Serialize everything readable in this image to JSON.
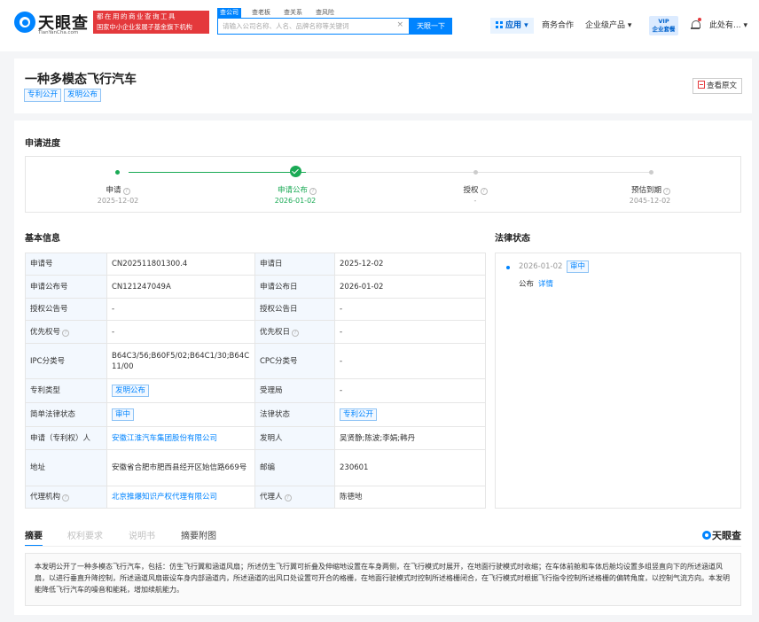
{
  "header": {
    "logo_text": "天眼查",
    "logo_sub": "TianYanCha.com",
    "banner_line1": "都在用的商业查询工具",
    "banner_line2": "国家中小企业发展子基金旗下机构",
    "search_tabs": [
      "查公司",
      "查老板",
      "查关系",
      "查风险"
    ],
    "search_placeholder": "请输入公司名称、人名、品牌名称等关键词",
    "search_clear": "×",
    "search_button": "天眼一下",
    "nav_app": "应用",
    "nav_business": "商务合作",
    "nav_enterprise": "企业级产品",
    "vip_line1": "VIP",
    "vip_line2": "企业套餐",
    "user_name": "此处有..."
  },
  "patent": {
    "title": "一种多模态飞行汽车",
    "tags": [
      "专利公开",
      "发明公布"
    ],
    "view_original": "查看原文"
  },
  "progress": {
    "title": "申请进度",
    "steps": [
      {
        "label": "申请",
        "date": "2025-12-02",
        "state": "done"
      },
      {
        "label": "申请公布",
        "date": "2026-01-02",
        "state": "current"
      },
      {
        "label": "授权",
        "date": "-",
        "state": "pending"
      },
      {
        "label": "预估到期",
        "date": "2045-12-02",
        "state": "pending"
      }
    ]
  },
  "basic_info": {
    "title": "基本信息",
    "rows": [
      {
        "k1": "申请号",
        "v1": "CN202511801300.4",
        "k2": "申请日",
        "v2": "2025-12-02"
      },
      {
        "k1": "申请公布号",
        "v1": "CN121247049A",
        "k2": "申请公布日",
        "v2": "2026-01-02"
      },
      {
        "k1": "授权公告号",
        "v1": "-",
        "k2": "授权公告日",
        "v2": "-"
      },
      {
        "k1": "优先权号",
        "v1": "-",
        "k2": "优先权日",
        "v2": "-"
      },
      {
        "k1": "IPC分类号",
        "v1": "B64C3/56;B60F5/02;B64C1/30;B64C11/00",
        "k2": "CPC分类号",
        "v2": "-"
      },
      {
        "k1": "专利类型",
        "v1": "发明公布",
        "k2": "受理局",
        "v2": "-"
      },
      {
        "k1": "简单法律状态",
        "v1": "审中",
        "k2": "法律状态",
        "v2": "专利公开"
      },
      {
        "k1": "申请（专利权）人",
        "v1": "安徽江淮汽车集团股份有限公司",
        "k2": "发明人",
        "v2": "吴贤静;陈波;李娟;韩丹"
      },
      {
        "k1": "地址",
        "v1": "安徽省合肥市肥西县经开区始信路669号",
        "k2": "邮编",
        "v2": "230601"
      },
      {
        "k1": "代理机构",
        "v1": "北京推爆知识产权代理有限公司",
        "k2": "代理人",
        "v2": "陈德地"
      }
    ]
  },
  "legal_status": {
    "title": "法律状态",
    "date": "2026-01-02",
    "tag": "审中",
    "type": "公布",
    "detail": "详情"
  },
  "tabs": {
    "items": [
      "摘要",
      "权利要求",
      "说明书",
      "摘要附图"
    ],
    "brand": "天眼查"
  },
  "abstract": "本发明公开了一种多模态飞行汽车，包括：仿生飞行翼和涵道风扇；所述仿生飞行翼可折叠及伸缩地设置在车身两侧，在飞行模式时展开，在地面行驶模式时收缩；在车体前舱和车体后舱均设置多组竖直向下的所述涵道风扇，以进行垂直升降控制，所述涵道风扇嵌设车身内部涵道内，所述涵道的出风口处设置可开合的格栅，在地面行驶模式时控制所述格栅闭合，在飞行模式时根据飞行指令控制所述格栅的偏转角度，以控制气流方向。本发明能降低飞行汽车的噪音和能耗，增加续航能力。"
}
